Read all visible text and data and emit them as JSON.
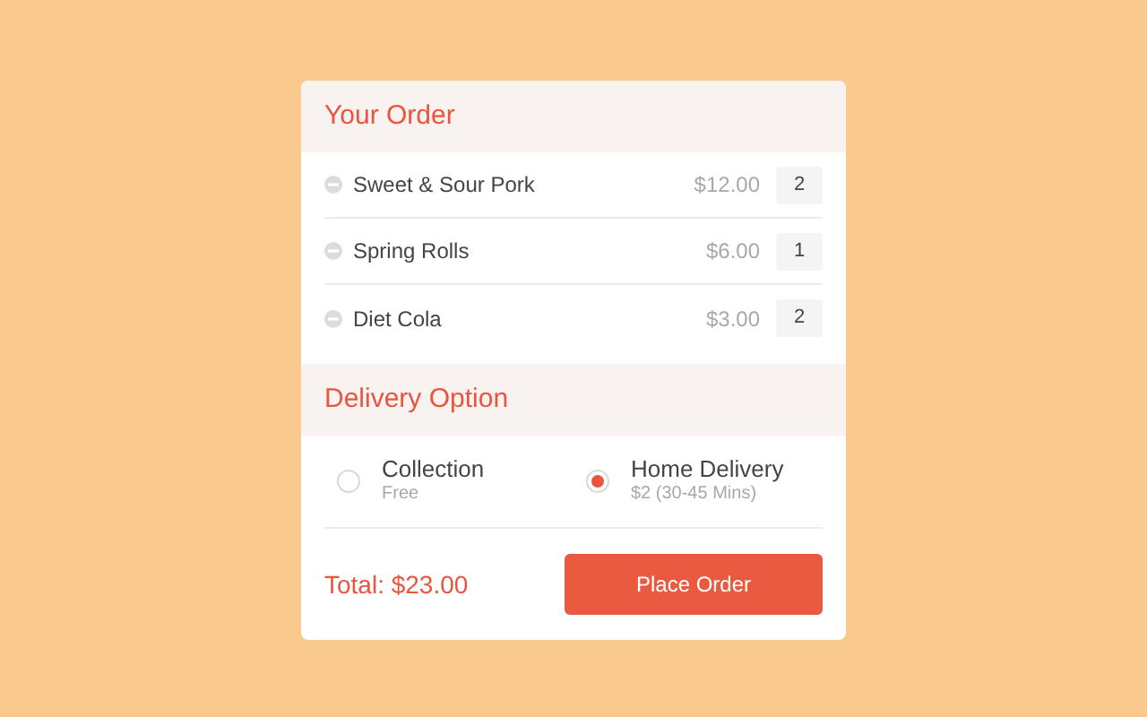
{
  "order": {
    "title": "Your Order",
    "items": [
      {
        "name": "Sweet & Sour Pork",
        "price": "$12.00",
        "quantity": "2"
      },
      {
        "name": "Spring Rolls",
        "price": "$6.00",
        "quantity": "1"
      },
      {
        "name": "Diet Cola",
        "price": "$3.00",
        "quantity": "2"
      }
    ]
  },
  "delivery": {
    "title": "Delivery Option",
    "options": [
      {
        "label": "Collection",
        "detail": "Free",
        "selected": false
      },
      {
        "label": "Home Delivery",
        "detail": "$2 (30-45 Mins)",
        "selected": true
      }
    ]
  },
  "total": "Total: $23.00",
  "button": "Place Order"
}
